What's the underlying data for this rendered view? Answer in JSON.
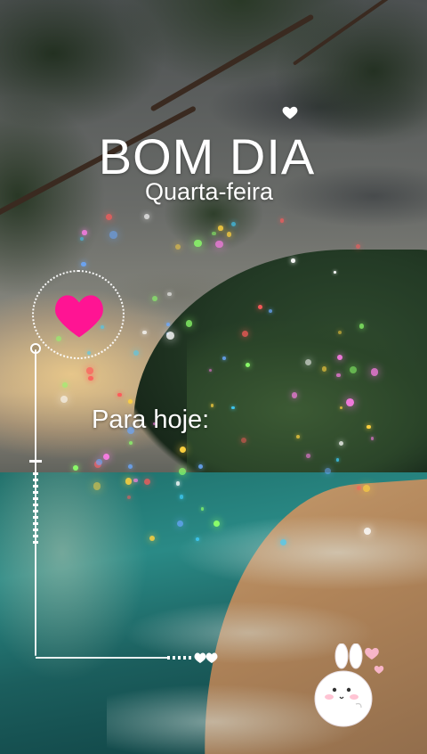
{
  "greeting": {
    "title": "BOM DIA",
    "weekday": "Quarta-feira"
  },
  "today": {
    "label": "Para hoje:"
  },
  "decorations": {
    "small_heart_icon": "white-heart-icon",
    "big_heart_icon": "pink-heart-icon",
    "end_icon": "double-heart-icon",
    "sticker": "bunny-sticker",
    "colors": {
      "heart_pink": "#ff1493",
      "line_white": "#ffffff",
      "text_white": "#ffffff"
    }
  }
}
